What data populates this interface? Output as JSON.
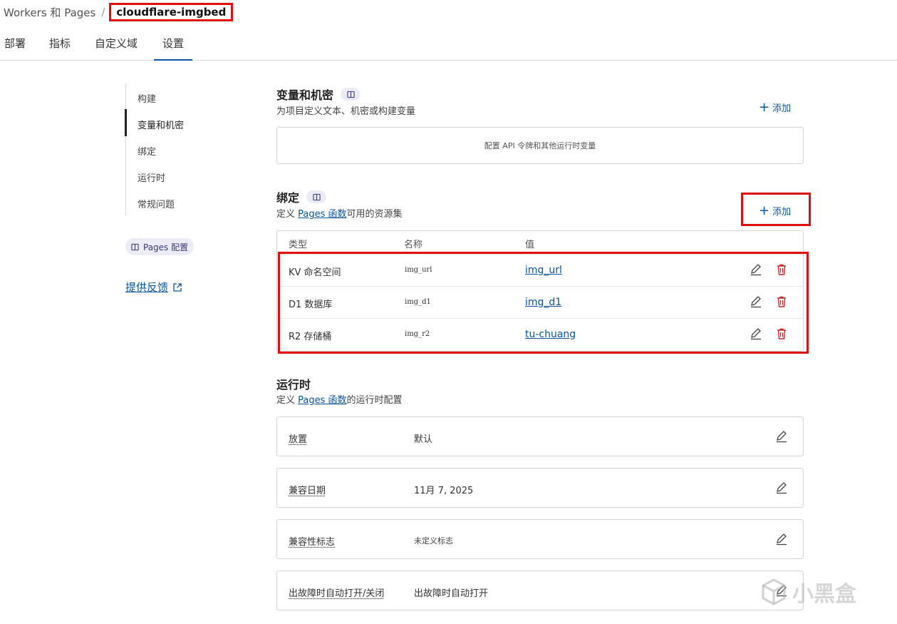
{
  "breadcrumb": {
    "parent": "Workers 和 Pages",
    "separator": "/",
    "current": "cloudflare-imgbed"
  },
  "tabs": [
    {
      "label": "部署"
    },
    {
      "label": "指标"
    },
    {
      "label": "自定义域"
    },
    {
      "label": "设置",
      "active": true
    }
  ],
  "sidenav": {
    "items": [
      {
        "label": "构建"
      },
      {
        "label": "变量和机密",
        "active": true
      },
      {
        "label": "绑定"
      },
      {
        "label": "运行时"
      },
      {
        "label": "常规问题"
      }
    ],
    "pages_config": "Pages 配置",
    "feedback": "提供反馈"
  },
  "variables": {
    "title": "变量和机密",
    "description": "为项目定义文本、机密或构建变量",
    "add_label": "添加",
    "empty_text": "配置 API 令牌和其他运行时变量"
  },
  "bindings": {
    "title": "绑定",
    "desc_prefix": "定义 ",
    "desc_link": "Pages 函数",
    "desc_suffix": "可用的资源集",
    "add_label": "添加",
    "columns": [
      "类型",
      "名称",
      "值"
    ],
    "rows": [
      {
        "type": "KV 命名空间",
        "name": "img_url",
        "value": "img_url"
      },
      {
        "type": "D1 数据库",
        "name": "img_d1",
        "value": "img_d1"
      },
      {
        "type": "R2 存储桶",
        "name": "img_r2",
        "value": "tu-chuang"
      }
    ]
  },
  "runtime": {
    "title": "运行时",
    "desc_prefix": "定义 ",
    "desc_link": "Pages 函数",
    "desc_suffix": "的运行时配置",
    "rows": [
      {
        "label": "放置",
        "value": "默认"
      },
      {
        "label": "兼容日期",
        "value": "11月 7, 2025"
      },
      {
        "label": "兼容性标志",
        "value": "未定义标志"
      },
      {
        "label": "出故障时自动打开/关闭",
        "value": "出故障时自动打开"
      }
    ]
  },
  "watermark": "小黑盒",
  "colors": {
    "accent": "#0b54a2",
    "highlight": "#e00f0f",
    "danger": "#c62828",
    "badge_bg": "#ececf6"
  }
}
